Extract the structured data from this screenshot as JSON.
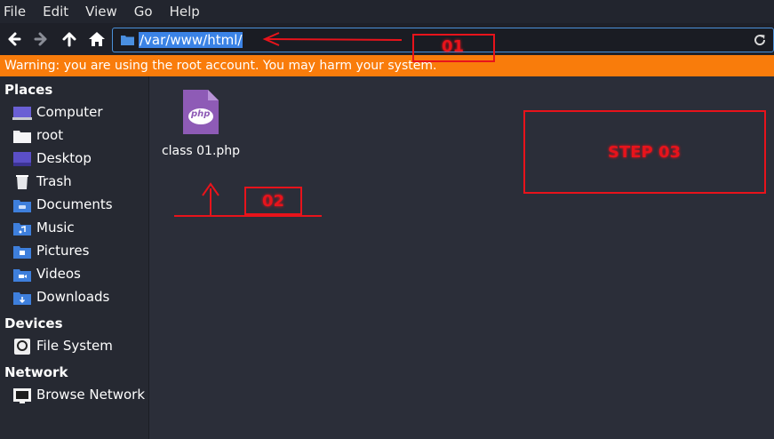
{
  "menu": [
    "File",
    "Edit",
    "View",
    "Go",
    "Help"
  ],
  "toolbar": {
    "back_icon": "arrow-left-icon",
    "forward_icon": "arrow-right-icon",
    "up_icon": "arrow-up-icon",
    "home_icon": "home-icon",
    "path": "/var/www/html/",
    "refresh_icon": "refresh-icon"
  },
  "warning": "Warning: you are using the root account. You may harm your system.",
  "sidebar": {
    "places_title": "Places",
    "places": [
      {
        "label": "Computer",
        "icon": "computer-icon"
      },
      {
        "label": "root",
        "icon": "home-folder-icon"
      },
      {
        "label": "Desktop",
        "icon": "desktop-icon"
      },
      {
        "label": "Trash",
        "icon": "trash-icon"
      },
      {
        "label": "Documents",
        "icon": "documents-folder-icon"
      },
      {
        "label": "Music",
        "icon": "music-folder-icon"
      },
      {
        "label": "Pictures",
        "icon": "pictures-folder-icon"
      },
      {
        "label": "Videos",
        "icon": "videos-folder-icon"
      },
      {
        "label": "Downloads",
        "icon": "downloads-folder-icon"
      }
    ],
    "devices_title": "Devices",
    "devices": [
      {
        "label": "File System",
        "icon": "drive-icon"
      }
    ],
    "network_title": "Network",
    "network": [
      {
        "label": "Browse Network",
        "icon": "network-icon"
      }
    ]
  },
  "files": [
    {
      "name": "class 01.php",
      "icon": "php-file-icon",
      "icon_text": "php"
    }
  ],
  "annotations": {
    "step1": "01",
    "step2": "02",
    "step3": "STEP 03"
  },
  "colors": {
    "accent": "#3b83e6",
    "warning": "#f97c0b",
    "annotation": "#e8131b",
    "php": "#8e5bb6"
  }
}
